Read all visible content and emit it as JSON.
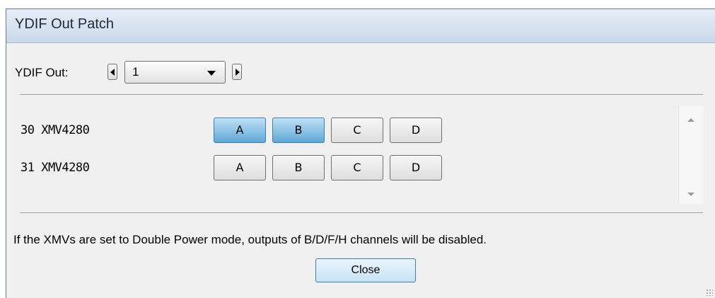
{
  "window": {
    "title": "YDIF Out Patch"
  },
  "ydif_out": {
    "label": "YDIF Out:",
    "value": "1"
  },
  "rows": [
    {
      "name": "30 XMV4280",
      "buttons": [
        {
          "label": "A",
          "active": true
        },
        {
          "label": "B",
          "active": true
        },
        {
          "label": "C",
          "active": false
        },
        {
          "label": "D",
          "active": false
        }
      ]
    },
    {
      "name": "31 XMV4280",
      "buttons": [
        {
          "label": "A",
          "active": false
        },
        {
          "label": "B",
          "active": false
        },
        {
          "label": "C",
          "active": false
        },
        {
          "label": "D",
          "active": false
        }
      ]
    }
  ],
  "note": "If the XMVs are set to Double Power mode, outputs of  B/D/F/H channels will be disabled.",
  "close_label": "Close",
  "colors": {
    "active": "#5ea8d4",
    "titlebar": "#c9d8ea"
  }
}
